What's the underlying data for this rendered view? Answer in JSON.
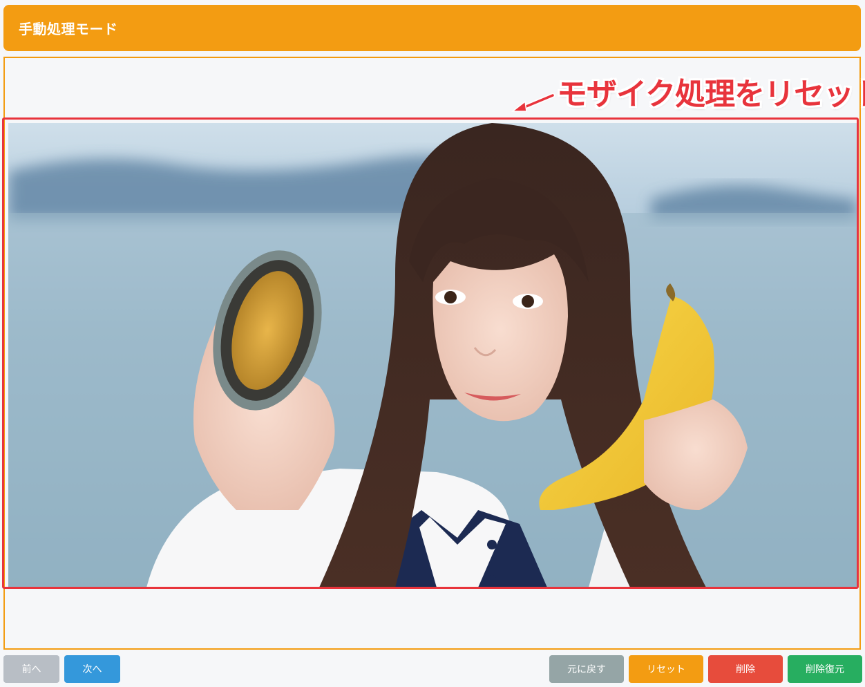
{
  "header": {
    "title": "手動処理モード"
  },
  "annotation": {
    "text": "モザイク処理をリセット",
    "color": "#e8343c"
  },
  "image": {
    "description_icon": "portrait-photo"
  },
  "buttons": {
    "prev": "前へ",
    "next": "次へ",
    "undo": "元に戻す",
    "reset": "リセット",
    "delete": "削除",
    "restore": "削除復元"
  },
  "colors": {
    "accent": "#f39c12",
    "primary": "#3498db",
    "danger": "#e74c3c",
    "success": "#27ae60",
    "muted": "#95a5a6",
    "disabled": "#b8bec5"
  }
}
